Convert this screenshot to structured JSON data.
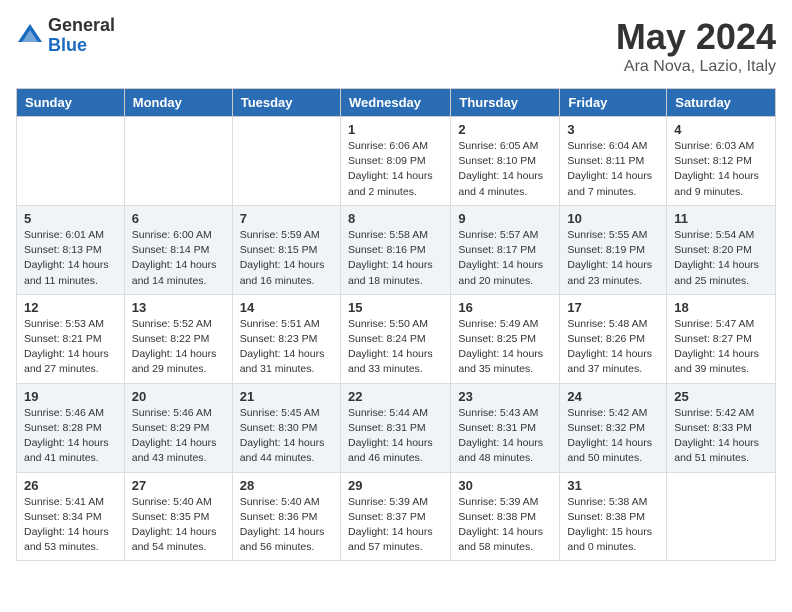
{
  "header": {
    "logo_general": "General",
    "logo_blue": "Blue",
    "title": "May 2024",
    "location": "Ara Nova, Lazio, Italy"
  },
  "weekdays": [
    "Sunday",
    "Monday",
    "Tuesday",
    "Wednesday",
    "Thursday",
    "Friday",
    "Saturday"
  ],
  "weeks": [
    [
      {
        "day": "",
        "info": ""
      },
      {
        "day": "",
        "info": ""
      },
      {
        "day": "",
        "info": ""
      },
      {
        "day": "1",
        "info": "Sunrise: 6:06 AM\nSunset: 8:09 PM\nDaylight: 14 hours\nand 2 minutes."
      },
      {
        "day": "2",
        "info": "Sunrise: 6:05 AM\nSunset: 8:10 PM\nDaylight: 14 hours\nand 4 minutes."
      },
      {
        "day": "3",
        "info": "Sunrise: 6:04 AM\nSunset: 8:11 PM\nDaylight: 14 hours\nand 7 minutes."
      },
      {
        "day": "4",
        "info": "Sunrise: 6:03 AM\nSunset: 8:12 PM\nDaylight: 14 hours\nand 9 minutes."
      }
    ],
    [
      {
        "day": "5",
        "info": "Sunrise: 6:01 AM\nSunset: 8:13 PM\nDaylight: 14 hours\nand 11 minutes."
      },
      {
        "day": "6",
        "info": "Sunrise: 6:00 AM\nSunset: 8:14 PM\nDaylight: 14 hours\nand 14 minutes."
      },
      {
        "day": "7",
        "info": "Sunrise: 5:59 AM\nSunset: 8:15 PM\nDaylight: 14 hours\nand 16 minutes."
      },
      {
        "day": "8",
        "info": "Sunrise: 5:58 AM\nSunset: 8:16 PM\nDaylight: 14 hours\nand 18 minutes."
      },
      {
        "day": "9",
        "info": "Sunrise: 5:57 AM\nSunset: 8:17 PM\nDaylight: 14 hours\nand 20 minutes."
      },
      {
        "day": "10",
        "info": "Sunrise: 5:55 AM\nSunset: 8:19 PM\nDaylight: 14 hours\nand 23 minutes."
      },
      {
        "day": "11",
        "info": "Sunrise: 5:54 AM\nSunset: 8:20 PM\nDaylight: 14 hours\nand 25 minutes."
      }
    ],
    [
      {
        "day": "12",
        "info": "Sunrise: 5:53 AM\nSunset: 8:21 PM\nDaylight: 14 hours\nand 27 minutes."
      },
      {
        "day": "13",
        "info": "Sunrise: 5:52 AM\nSunset: 8:22 PM\nDaylight: 14 hours\nand 29 minutes."
      },
      {
        "day": "14",
        "info": "Sunrise: 5:51 AM\nSunset: 8:23 PM\nDaylight: 14 hours\nand 31 minutes."
      },
      {
        "day": "15",
        "info": "Sunrise: 5:50 AM\nSunset: 8:24 PM\nDaylight: 14 hours\nand 33 minutes."
      },
      {
        "day": "16",
        "info": "Sunrise: 5:49 AM\nSunset: 8:25 PM\nDaylight: 14 hours\nand 35 minutes."
      },
      {
        "day": "17",
        "info": "Sunrise: 5:48 AM\nSunset: 8:26 PM\nDaylight: 14 hours\nand 37 minutes."
      },
      {
        "day": "18",
        "info": "Sunrise: 5:47 AM\nSunset: 8:27 PM\nDaylight: 14 hours\nand 39 minutes."
      }
    ],
    [
      {
        "day": "19",
        "info": "Sunrise: 5:46 AM\nSunset: 8:28 PM\nDaylight: 14 hours\nand 41 minutes."
      },
      {
        "day": "20",
        "info": "Sunrise: 5:46 AM\nSunset: 8:29 PM\nDaylight: 14 hours\nand 43 minutes."
      },
      {
        "day": "21",
        "info": "Sunrise: 5:45 AM\nSunset: 8:30 PM\nDaylight: 14 hours\nand 44 minutes."
      },
      {
        "day": "22",
        "info": "Sunrise: 5:44 AM\nSunset: 8:31 PM\nDaylight: 14 hours\nand 46 minutes."
      },
      {
        "day": "23",
        "info": "Sunrise: 5:43 AM\nSunset: 8:31 PM\nDaylight: 14 hours\nand 48 minutes."
      },
      {
        "day": "24",
        "info": "Sunrise: 5:42 AM\nSunset: 8:32 PM\nDaylight: 14 hours\nand 50 minutes."
      },
      {
        "day": "25",
        "info": "Sunrise: 5:42 AM\nSunset: 8:33 PM\nDaylight: 14 hours\nand 51 minutes."
      }
    ],
    [
      {
        "day": "26",
        "info": "Sunrise: 5:41 AM\nSunset: 8:34 PM\nDaylight: 14 hours\nand 53 minutes."
      },
      {
        "day": "27",
        "info": "Sunrise: 5:40 AM\nSunset: 8:35 PM\nDaylight: 14 hours\nand 54 minutes."
      },
      {
        "day": "28",
        "info": "Sunrise: 5:40 AM\nSunset: 8:36 PM\nDaylight: 14 hours\nand 56 minutes."
      },
      {
        "day": "29",
        "info": "Sunrise: 5:39 AM\nSunset: 8:37 PM\nDaylight: 14 hours\nand 57 minutes."
      },
      {
        "day": "30",
        "info": "Sunrise: 5:39 AM\nSunset: 8:38 PM\nDaylight: 14 hours\nand 58 minutes."
      },
      {
        "day": "31",
        "info": "Sunrise: 5:38 AM\nSunset: 8:38 PM\nDaylight: 15 hours\nand 0 minutes."
      },
      {
        "day": "",
        "info": ""
      }
    ]
  ]
}
